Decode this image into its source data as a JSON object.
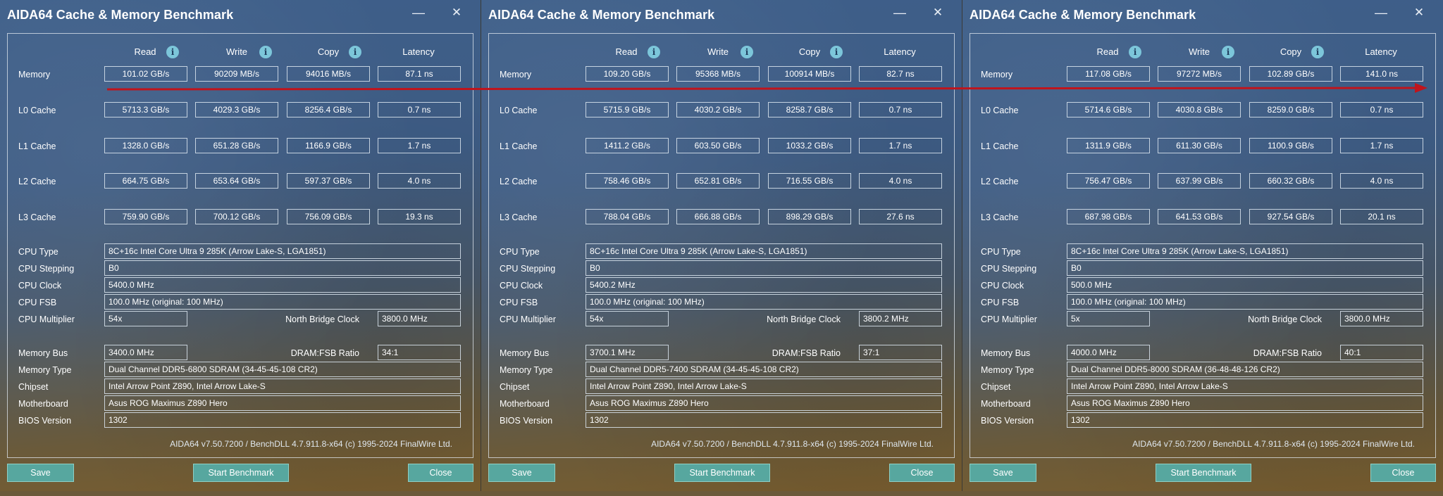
{
  "windows": [
    {
      "title": "AIDA64 Cache & Memory Benchmark",
      "headers": [
        "Read",
        "Write",
        "Copy",
        "Latency"
      ],
      "rows": [
        {
          "label": "Memory",
          "values": [
            "101.02 GB/s",
            "90209 MB/s",
            "94016 MB/s",
            "87.1 ns"
          ]
        },
        {
          "label": "L0 Cache",
          "values": [
            "5713.3 GB/s",
            "4029.3 GB/s",
            "8256.4 GB/s",
            "0.7 ns"
          ]
        },
        {
          "label": "L1 Cache",
          "values": [
            "1328.0 GB/s",
            "651.28 GB/s",
            "1166.9 GB/s",
            "1.7 ns"
          ]
        },
        {
          "label": "L2 Cache",
          "values": [
            "664.75 GB/s",
            "653.64 GB/s",
            "597.37 GB/s",
            "4.0 ns"
          ]
        },
        {
          "label": "L3 Cache",
          "values": [
            "759.90 GB/s",
            "700.12 GB/s",
            "756.09 GB/s",
            "19.3 ns"
          ]
        }
      ],
      "cpu_type_label": "CPU Type",
      "cpu_type": "8C+16c Intel Core Ultra 9 285K  (Arrow Lake-S, LGA1851)",
      "cpu_stepping_label": "CPU Stepping",
      "cpu_stepping": "B0",
      "cpu_clock_label": "CPU Clock",
      "cpu_clock": "5400.0 MHz",
      "cpu_fsb_label": "CPU FSB",
      "cpu_fsb": "100.0 MHz  (original: 100 MHz)",
      "cpu_multiplier_label": "CPU Multiplier",
      "cpu_multiplier": "54x",
      "nb_clock_label": "North Bridge Clock",
      "nb_clock": "3800.0 MHz",
      "memory_bus_label": "Memory Bus",
      "memory_bus": "3400.0 MHz",
      "dram_ratio_label": "DRAM:FSB Ratio",
      "dram_ratio": "34:1",
      "memory_type_label": "Memory Type",
      "memory_type": "Dual Channel DDR5-6800 SDRAM  (34-45-45-108 CR2)",
      "chipset_label": "Chipset",
      "chipset": "Intel Arrow Point Z890, Intel Arrow Lake-S",
      "motherboard_label": "Motherboard",
      "motherboard": "Asus ROG Maximus Z890 Hero",
      "bios_label": "BIOS Version",
      "bios": "1302",
      "footer": "AIDA64 v7.50.7200 / BenchDLL 4.7.911.8-x64  (c) 1995-2024 FinalWire Ltd.",
      "save_label": "Save",
      "start_label": "Start Benchmark",
      "close_label": "Close"
    },
    {
      "title": "AIDA64 Cache & Memory Benchmark",
      "headers": [
        "Read",
        "Write",
        "Copy",
        "Latency"
      ],
      "rows": [
        {
          "label": "Memory",
          "values": [
            "109.20 GB/s",
            "95368 MB/s",
            "100914 MB/s",
            "82.7 ns"
          ]
        },
        {
          "label": "L0 Cache",
          "values": [
            "5715.9 GB/s",
            "4030.2 GB/s",
            "8258.7 GB/s",
            "0.7 ns"
          ]
        },
        {
          "label": "L1 Cache",
          "values": [
            "1411.2 GB/s",
            "603.50 GB/s",
            "1033.2 GB/s",
            "1.7 ns"
          ]
        },
        {
          "label": "L2 Cache",
          "values": [
            "758.46 GB/s",
            "652.81 GB/s",
            "716.55 GB/s",
            "4.0 ns"
          ]
        },
        {
          "label": "L3 Cache",
          "values": [
            "788.04 GB/s",
            "666.88 GB/s",
            "898.29 GB/s",
            "27.6 ns"
          ]
        }
      ],
      "cpu_type_label": "CPU Type",
      "cpu_type": "8C+16c Intel Core Ultra 9 285K  (Arrow Lake-S, LGA1851)",
      "cpu_stepping_label": "CPU Stepping",
      "cpu_stepping": "B0",
      "cpu_clock_label": "CPU Clock",
      "cpu_clock": "5400.2 MHz",
      "cpu_fsb_label": "CPU FSB",
      "cpu_fsb": "100.0 MHz  (original: 100 MHz)",
      "cpu_multiplier_label": "CPU Multiplier",
      "cpu_multiplier": "54x",
      "nb_clock_label": "North Bridge Clock",
      "nb_clock": "3800.2 MHz",
      "memory_bus_label": "Memory Bus",
      "memory_bus": "3700.1 MHz",
      "dram_ratio_label": "DRAM:FSB Ratio",
      "dram_ratio": "37:1",
      "memory_type_label": "Memory Type",
      "memory_type": "Dual Channel DDR5-7400 SDRAM  (34-45-45-108 CR2)",
      "chipset_label": "Chipset",
      "chipset": "Intel Arrow Point Z890, Intel Arrow Lake-S",
      "motherboard_label": "Motherboard",
      "motherboard": "Asus ROG Maximus Z890 Hero",
      "bios_label": "BIOS Version",
      "bios": "1302",
      "footer": "AIDA64 v7.50.7200 / BenchDLL 4.7.911.8-x64  (c) 1995-2024 FinalWire Ltd.",
      "save_label": "Save",
      "start_label": "Start Benchmark",
      "close_label": "Close"
    },
    {
      "title": "AIDA64 Cache & Memory Benchmark",
      "headers": [
        "Read",
        "Write",
        "Copy",
        "Latency"
      ],
      "rows": [
        {
          "label": "Memory",
          "values": [
            "117.08 GB/s",
            "97272 MB/s",
            "102.89 GB/s",
            "141.0 ns"
          ]
        },
        {
          "label": "L0 Cache",
          "values": [
            "5714.6 GB/s",
            "4030.8 GB/s",
            "8259.0 GB/s",
            "0.7 ns"
          ]
        },
        {
          "label": "L1 Cache",
          "values": [
            "1311.9 GB/s",
            "611.30 GB/s",
            "1100.9 GB/s",
            "1.7 ns"
          ]
        },
        {
          "label": "L2 Cache",
          "values": [
            "756.47 GB/s",
            "637.99 GB/s",
            "660.32 GB/s",
            "4.0 ns"
          ]
        },
        {
          "label": "L3 Cache",
          "values": [
            "687.98 GB/s",
            "641.53 GB/s",
            "927.54 GB/s",
            "20.1 ns"
          ]
        }
      ],
      "cpu_type_label": "CPU Type",
      "cpu_type": "8C+16c Intel Core Ultra 9 285K  (Arrow Lake-S, LGA1851)",
      "cpu_stepping_label": "CPU Stepping",
      "cpu_stepping": "B0",
      "cpu_clock_label": "CPU Clock",
      "cpu_clock": "500.0 MHz",
      "cpu_fsb_label": "CPU FSB",
      "cpu_fsb": "100.0 MHz  (original: 100 MHz)",
      "cpu_multiplier_label": "CPU Multiplier",
      "cpu_multiplier": "5x",
      "nb_clock_label": "North Bridge Clock",
      "nb_clock": "3800.0 MHz",
      "memory_bus_label": "Memory Bus",
      "memory_bus": "4000.0 MHz",
      "dram_ratio_label": "DRAM:FSB Ratio",
      "dram_ratio": "40:1",
      "memory_type_label": "Memory Type",
      "memory_type": "Dual Channel DDR5-8000 SDRAM  (36-48-48-126 CR2)",
      "chipset_label": "Chipset",
      "chipset": "Intel Arrow Point Z890, Intel Arrow Lake-S",
      "motherboard_label": "Motherboard",
      "motherboard": "Asus ROG Maximus Z890 Hero",
      "bios_label": "BIOS Version",
      "bios": "1302",
      "footer": "AIDA64 v7.50.7200 / BenchDLL 4.7.911.8-x64  (c) 1995-2024 FinalWire Ltd.",
      "save_label": "Save",
      "start_label": "Start Benchmark",
      "close_label": "Close"
    }
  ],
  "icons": {
    "info": "info-icon",
    "minimize": "minimize-icon",
    "close": "close-icon"
  },
  "colors": {
    "accent_button": "#57a79f",
    "annotation_arrow": "#c0141c"
  }
}
